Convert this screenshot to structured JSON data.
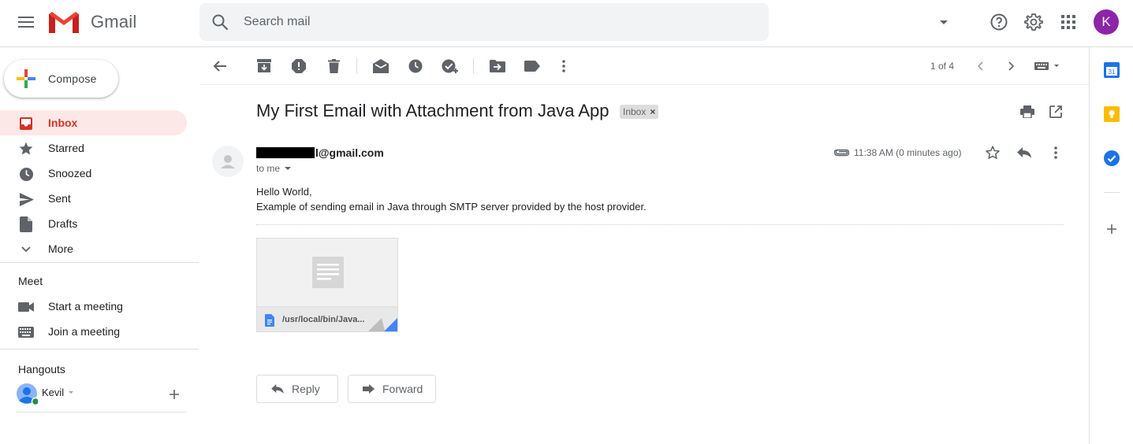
{
  "header": {
    "app_name": "Gmail",
    "search_placeholder": "Search mail",
    "avatar_initial": "K",
    "colors": {
      "avatar_bg": "#8e24aa",
      "search_bg": "#f1f3f4"
    }
  },
  "sidebar": {
    "compose_label": "Compose",
    "items": [
      {
        "label": "Inbox",
        "icon": "inbox-icon",
        "active": true
      },
      {
        "label": "Starred",
        "icon": "star-icon"
      },
      {
        "label": "Snoozed",
        "icon": "clock-icon"
      },
      {
        "label": "Sent",
        "icon": "send-icon"
      },
      {
        "label": "Drafts",
        "icon": "draft-icon"
      },
      {
        "label": "More",
        "icon": "chevron-down-icon"
      }
    ],
    "meet": {
      "title": "Meet",
      "items": [
        {
          "label": "Start a meeting",
          "icon": "video-camera-icon"
        },
        {
          "label": "Join a meeting",
          "icon": "keyboard-icon"
        }
      ]
    },
    "hangouts": {
      "title": "Hangouts",
      "user_name": "Kevil"
    }
  },
  "toolbar": {
    "pager": "1 of 4",
    "icons": [
      "back-arrow-icon",
      "archive-icon",
      "report-spam-icon",
      "delete-icon",
      "mark-unread-icon",
      "snooze-icon",
      "add-task-icon",
      "move-to-icon",
      "label-icon",
      "more-vert-icon"
    ]
  },
  "email": {
    "subject": "My First Email with Attachment from Java App",
    "label": "Inbox",
    "sender_visible": "l@gmail.com",
    "recipient": "to me",
    "time": "11:38 AM (0 minutes ago)",
    "body_lines": [
      "Hello World,",
      "Example of sending email in Java through SMTP server provided by the host provider."
    ],
    "attachment_name": "/usr/local/bin/Java...",
    "reply_label": "Reply",
    "forward_label": "Forward"
  }
}
